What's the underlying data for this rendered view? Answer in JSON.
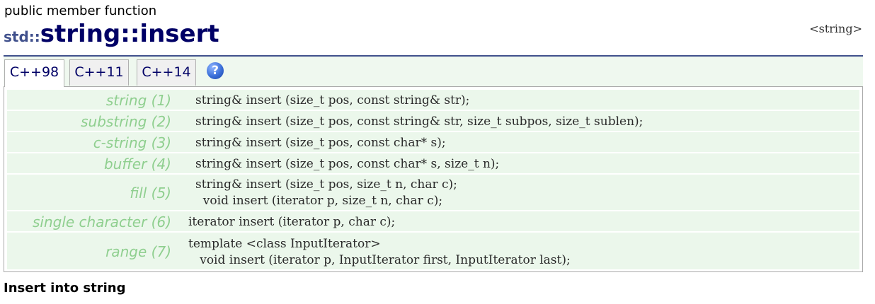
{
  "header": {
    "kind": "public member function",
    "namespace": "std::",
    "name": "string::insert",
    "file": "<string>"
  },
  "tabs": [
    {
      "label": "C++98",
      "active": true
    },
    {
      "label": "C++11",
      "active": false
    },
    {
      "label": "C++14",
      "active": false
    }
  ],
  "help_icon": {
    "icon": "help-icon",
    "glyph": "?"
  },
  "signatures": [
    {
      "label": "string (1)",
      "lines": [
        "string& insert (size_t pos, const string& str);"
      ]
    },
    {
      "label": "substring (2)",
      "lines": [
        "string& insert (size_t pos, const string& str, size_t subpos, size_t sublen);"
      ]
    },
    {
      "label": "c-string (3)",
      "lines": [
        "string& insert (size_t pos, const char* s);"
      ]
    },
    {
      "label": "buffer (4)",
      "lines": [
        "string& insert (size_t pos, const char* s, size_t n);"
      ]
    },
    {
      "label": "fill (5)",
      "lines": [
        "string& insert (size_t pos, size_t n, char c);",
        "  void insert (iterator p, size_t n, char c);"
      ]
    },
    {
      "label": "single character (6)",
      "lines": [
        "iterator insert (iterator p, char c);"
      ]
    },
    {
      "label": "range (7)",
      "lines": [
        "template <class InputIterator>",
        "   void insert (iterator p, InputIterator first, InputIterator last);"
      ]
    }
  ],
  "section": {
    "title": "Insert into string"
  },
  "colors": {
    "accent": "#40508c",
    "title": "#000066",
    "label": "#8fcf8f",
    "row_background": "#ebf7eb"
  }
}
